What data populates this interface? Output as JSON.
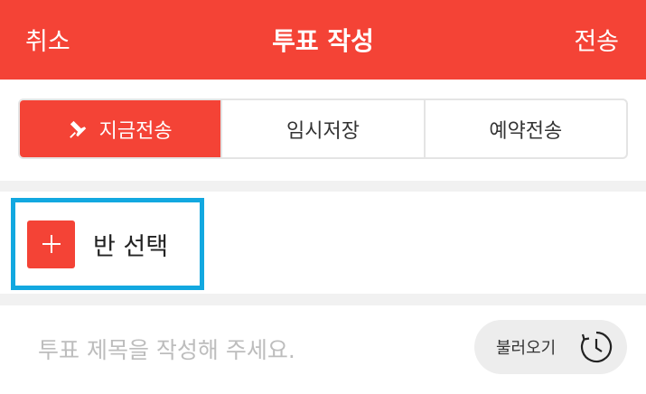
{
  "header": {
    "cancel_label": "취소",
    "title": "투표 작성",
    "send_label": "전송",
    "background_color": "#f44336"
  },
  "send_mode": {
    "tabs": [
      {
        "label": "지금전송",
        "icon": "pin-icon",
        "active": true
      },
      {
        "label": "임시저장",
        "active": false
      },
      {
        "label": "예약전송",
        "active": false
      }
    ]
  },
  "class_select": {
    "icon": "plus-icon",
    "label": "반 선택",
    "highlight_color": "#12a8e0"
  },
  "vote_title": {
    "placeholder": "투표 제목을 작성해 주세요.",
    "load_label": "불러오기",
    "load_icon": "clock-history-icon"
  }
}
